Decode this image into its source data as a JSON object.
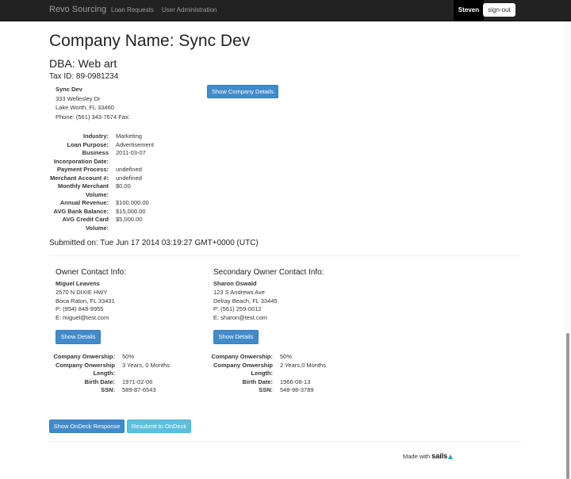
{
  "nav": {
    "brand": "Revo Sourcing",
    "links": [
      "Loan Requests",
      "User Administration"
    ],
    "user": "Steven",
    "signout": "sign-out"
  },
  "company": {
    "title": "Company Name: Sync Dev",
    "dba": "DBA: Web art",
    "tax_id": "Tax ID: 89-0981234",
    "address": {
      "name": "Sync Dev",
      "street": "333 Wellesley Dr",
      "city": "Lake Worth, FL 33460",
      "phone": "Phone: (561) 343-7674 Fax:"
    },
    "details_button": "Show Company Details",
    "fields": [
      {
        "label": "Industry:",
        "value": "Marketing"
      },
      {
        "label": "Loan Purpose:",
        "value": "Advertisement"
      },
      {
        "label": "Business Incorporation Date:",
        "value": "2011-03-07"
      },
      {
        "label": "Payment Process:",
        "value": "undefined"
      },
      {
        "label": "Merchant Account #:",
        "value": "undefined"
      },
      {
        "label": "Monthly Merchant Volume:",
        "value": "$0.00"
      },
      {
        "label": "Annual Revenue:",
        "value": "$100,000.00"
      },
      {
        "label": "AVG Bank Balance:",
        "value": "$15,000.00"
      },
      {
        "label": "AVG Credit Card Volume:",
        "value": "$5,000.00"
      }
    ],
    "submitted": "Submitted on: Tue Jun 17 2014 03:19:27 GMT+0000 (UTC)"
  },
  "owners": [
    {
      "heading": "Owner Contact Info:",
      "name": "Miguel Leavens",
      "street": "2570 N DIXIE HWY",
      "city": "Boca Raton, FL 33431",
      "phone": "P: (954) 848-9955",
      "email": "E: miguel@test.com",
      "details_button": "Show Details",
      "fields": [
        {
          "label": "Company Onwership:",
          "value": "50%"
        },
        {
          "label": "Company Onwership Length:",
          "value": "3 Years, 0 Months"
        },
        {
          "label": "Birth Date:",
          "value": "1971-02-06"
        },
        {
          "label": "SSN:",
          "value": "589-87-6543"
        }
      ]
    },
    {
      "heading": "Secondary Owner Contact Info:",
      "name": "Sharon Oswald",
      "street": "123 S Andrews Ave",
      "city": "Delray Beach, FL 33445",
      "phone": "P: (561) 259-0012",
      "email": "E: sharon@test.com",
      "details_button": "Show Details",
      "fields": [
        {
          "label": "Company Onwership:",
          "value": "50%"
        },
        {
          "label": "Company Onwership Length:",
          "value": "2 Years,0 Months"
        },
        {
          "label": "Birth Date:",
          "value": "1966-08-13"
        },
        {
          "label": "SSN:",
          "value": "548-98-3789"
        }
      ]
    }
  ],
  "actions": {
    "ondeck_response": "Show OnDeck Response",
    "resubmit": "Resubmit to OnDeck"
  },
  "footer": {
    "made_with": "Made with",
    "sails": "sails"
  }
}
